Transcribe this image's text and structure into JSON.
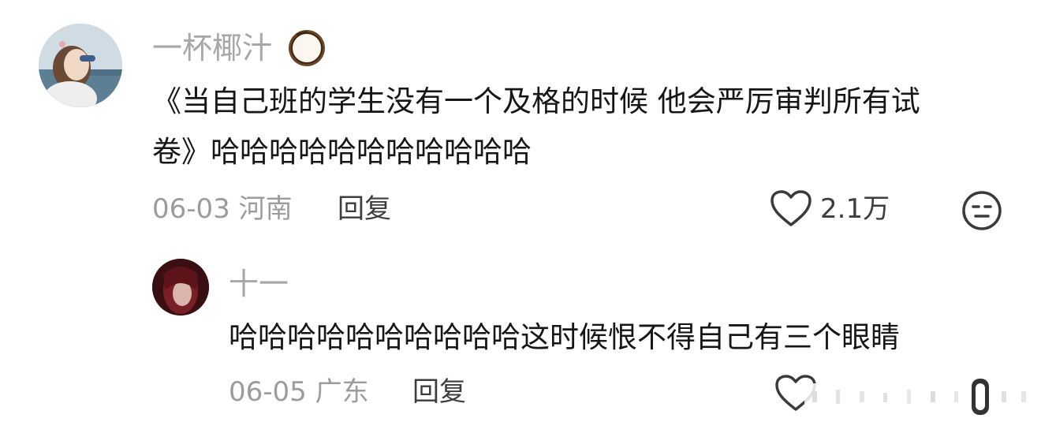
{
  "comment_main": {
    "username": "一杯椰汁",
    "username_emoji": "coconut-icon",
    "text_line1": "《当自己班的学生没有一个及格的时候 他会严厉审判所有试",
    "text_line2": "卷》哈哈哈哈哈哈哈哈哈哈哈",
    "date_location": "06-03 河南",
    "reply_label": "回复",
    "like_icon": "heart-icon",
    "like_count": "2.1万",
    "react_icon": "face-emoji-icon"
  },
  "reply_comment": {
    "username": "十一",
    "text": "哈哈哈哈哈哈哈哈哈哈这时候恨不得自己有三个眼睛",
    "date_location": "06-05 广东",
    "reply_label": "回复",
    "like_icon": "heart-icon"
  },
  "colors": {
    "username": "#a7a7a7",
    "body_text": "#161616",
    "meta_text": "#9c9c9c",
    "action_text": "#3d3d3d"
  }
}
